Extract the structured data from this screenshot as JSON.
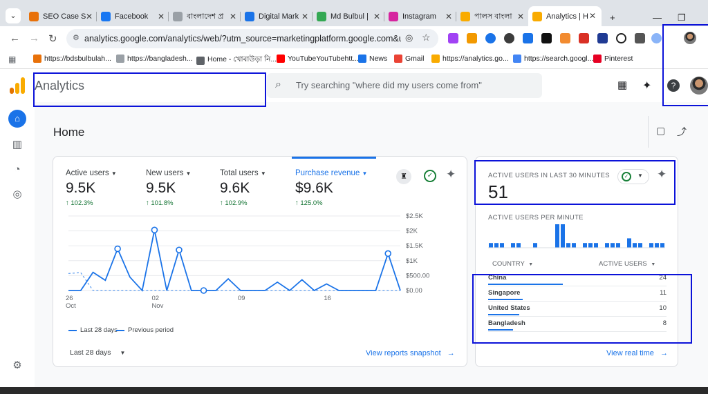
{
  "browser": {
    "tabs": [
      {
        "title": "SEO Case St",
        "color": "#e8710a"
      },
      {
        "title": "Facebook",
        "color": "#1877f2"
      },
      {
        "title": "বাংলাদেশ প্র",
        "color": "#9aa0a6"
      },
      {
        "title": "Digital Mark",
        "color": "#1a73e8"
      },
      {
        "title": "Md Bulbul |",
        "color": "#34a853"
      },
      {
        "title": "Instagram",
        "color": "#d6249f"
      },
      {
        "title": "পালস বাংলা",
        "color": "#f9ab00"
      },
      {
        "title": "Analytics | H",
        "color": "#f9ab00"
      }
    ],
    "new_tab": "+",
    "url": "analytics.google.com/analytics/web/?utm_source=marketingplatform.google.com&utm_medi...",
    "bookmarks": [
      {
        "label": "https://bdsbulbulah...",
        "color": "#e8710a"
      },
      {
        "label": "https://bangladesh...",
        "color": "#9aa0a6"
      },
      {
        "label": "Home - খোবাউড়া নি...",
        "color": "#5f6368"
      },
      {
        "label": "YouTubeYouTubehtt...",
        "color": "#ff0000"
      },
      {
        "label": "News",
        "color": "#1a73e8"
      },
      {
        "label": "Gmail",
        "color": "#ea4335"
      },
      {
        "label": "https://analytics.go...",
        "color": "#f9ab00"
      },
      {
        "label": "https://search.googl...",
        "color": "#4285f4"
      },
      {
        "label": "Pinterest",
        "color": "#e60023"
      }
    ]
  },
  "header": {
    "app_title": "Analytics",
    "search_placeholder": "Try searching \"where did my users come from\""
  },
  "page": {
    "title": "Home"
  },
  "metrics": [
    {
      "label": "Active users",
      "value": "9.5K",
      "change": "102.3%"
    },
    {
      "label": "New users",
      "value": "9.5K",
      "change": "101.8%"
    },
    {
      "label": "Total users",
      "value": "9.6K",
      "change": "102.9%"
    },
    {
      "label": "Purchase revenue",
      "value": "$9.6K",
      "change": "125.0%"
    }
  ],
  "chart_data": {
    "type": "line",
    "x_ticks": [
      {
        "day": "26",
        "month": "Oct"
      },
      {
        "day": "02",
        "month": "Nov"
      },
      {
        "day": "09",
        "month": ""
      },
      {
        "day": "16",
        "month": ""
      }
    ],
    "y_ticks": [
      "$2.5K",
      "$2K",
      "$1.5K",
      "$1K",
      "$500.00",
      "$0.00"
    ],
    "ylim": [
      0,
      2500
    ],
    "series": [
      {
        "name": "Last 28 days",
        "style": "solid",
        "color": "#1a73e8",
        "values": [
          0,
          0,
          610,
          340,
          1400,
          450,
          0,
          2030,
          0,
          1360,
          0,
          0,
          0,
          390,
          0,
          0,
          0,
          280,
          0,
          360,
          0,
          220,
          0,
          0,
          0,
          0,
          1240,
          0
        ]
      },
      {
        "name": "Previous period",
        "style": "dashed",
        "color": "#1a73e8",
        "values": [
          570,
          600,
          0,
          0,
          0,
          0,
          0,
          0,
          0,
          0,
          0,
          0,
          0,
          0,
          0,
          0,
          0,
          0,
          0,
          0,
          0,
          0,
          0,
          0,
          0,
          0,
          0,
          0
        ]
      }
    ],
    "legend": [
      "Last 28 days",
      "Previous period"
    ]
  },
  "overview_footer": {
    "range": "Last 28 days",
    "link": "View reports snapshot"
  },
  "realtime": {
    "heading": "ACTIVE USERS IN LAST 30 MINUTES",
    "value": "51",
    "per_minute_label": "ACTIVE USERS PER MINUTE",
    "per_minute": [
      1,
      1,
      1,
      0,
      1,
      1,
      0,
      0,
      1,
      0,
      0,
      0,
      5,
      5,
      1,
      1,
      0,
      1,
      1,
      1,
      0,
      1,
      1,
      1,
      0,
      2,
      1,
      1,
      0,
      1,
      1,
      1
    ],
    "col_country": "COUNTRY",
    "col_users": "ACTIVE USERS",
    "countries": [
      {
        "name": "China",
        "users": "24",
        "share": 1.0
      },
      {
        "name": "Singapore",
        "users": "11",
        "share": 0.46
      },
      {
        "name": "United States",
        "users": "10",
        "share": 0.42
      },
      {
        "name": "Bangladesh",
        "users": "8",
        "share": 0.33
      }
    ],
    "link": "View real time"
  }
}
